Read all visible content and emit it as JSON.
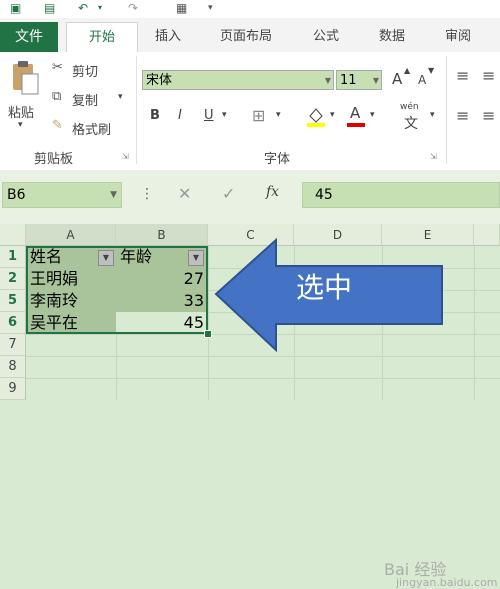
{
  "ribbon_tabs": {
    "file": "文件",
    "home": "开始",
    "insert": "插入",
    "page_layout": "页面布局",
    "formulas": "公式",
    "data": "数据",
    "review": "审阅"
  },
  "clipboard": {
    "paste": "粘贴",
    "cut": "剪切",
    "copy": "复制",
    "format_painter": "格式刷",
    "group_label": "剪贴板"
  },
  "font": {
    "name": "宋体",
    "size": "11",
    "group_label": "字体",
    "grow": "A",
    "shrink": "A",
    "bold": "B",
    "italic": "I",
    "underline": "U",
    "wen": "wén",
    "wen_char": "文",
    "font_color_letter": "A"
  },
  "formula_bar": {
    "name_box": "B6",
    "value": "45",
    "fx": "fx"
  },
  "grid": {
    "columns": [
      "A",
      "B",
      "C",
      "D",
      "E"
    ],
    "rows": [
      "1",
      "2",
      "5",
      "6",
      "7",
      "8",
      "9"
    ],
    "header_a": "姓名",
    "header_b": "年龄",
    "data": [
      {
        "name": "王明娟",
        "age": "27"
      },
      {
        "name": "李南玲",
        "age": "33"
      },
      {
        "name": "吴平在",
        "age": "45"
      }
    ]
  },
  "callout": {
    "text": "选中"
  },
  "watermark": {
    "brand": "Bai 经验",
    "url": "jingyan.baidu.com"
  },
  "colors": {
    "excel_green": "#217346",
    "selection": "#a9c49a",
    "callout": "#4472c4"
  }
}
